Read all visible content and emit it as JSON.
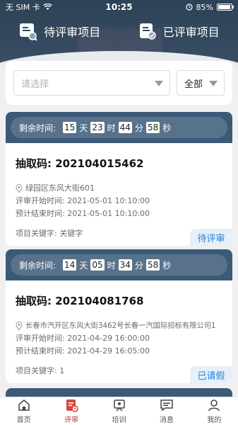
{
  "status_bar": {
    "carrier": "无 SIM 卡",
    "time": "10:25",
    "battery": "85%"
  },
  "tabs": [
    {
      "label": "待评审项目",
      "icon": "pending-review-icon"
    },
    {
      "label": "已评审项目",
      "icon": "reviewed-icon"
    }
  ],
  "filter": {
    "select_placeholder": "请选择",
    "scope_value": "全部"
  },
  "cards": [
    {
      "remaining_label": "剩余时间:",
      "days": "15",
      "day_unit": "天",
      "hours": "23",
      "hour_unit": "时",
      "minutes": "44",
      "minute_unit": "分",
      "seconds": "58",
      "second_unit": "秒",
      "code_label": "抽取码:",
      "code": "202104015462",
      "address": "绿园区东风大街601",
      "start": "评审开始时间:   2021-05-01 10:10:00",
      "end": "预计结束时间:   2021-05-01 10:10:00",
      "keyword": "项目关键字: 关键字",
      "status": "待评审"
    },
    {
      "remaining_label": "剩余时间:",
      "days": "14",
      "day_unit": "天",
      "hours": "05",
      "hour_unit": "时",
      "minutes": "34",
      "minute_unit": "分",
      "seconds": "58",
      "second_unit": "秒",
      "code_label": "抽取码:",
      "code": "202104081768",
      "address": "长春市汽开区东风大街3462号长春一汽国际招标有限公司1",
      "start": "评审开始时间:   2021-04-29 16:00:00",
      "end": "预计结束时间:   2021-04-29 16:05:00",
      "keyword": "项目关键字: 1",
      "status": "已请假"
    }
  ],
  "nav": [
    {
      "label": "首页",
      "icon": "home-icon"
    },
    {
      "label": "评审",
      "icon": "review-icon",
      "active": true
    },
    {
      "label": "培训",
      "icon": "training-icon"
    },
    {
      "label": "消息",
      "icon": "message-icon"
    },
    {
      "label": "我的",
      "icon": "profile-icon"
    }
  ],
  "colors": {
    "header": "#34495f",
    "card_top": "#3c5a78",
    "accent": "#2a7fd0",
    "active_nav": "#c0392b"
  }
}
